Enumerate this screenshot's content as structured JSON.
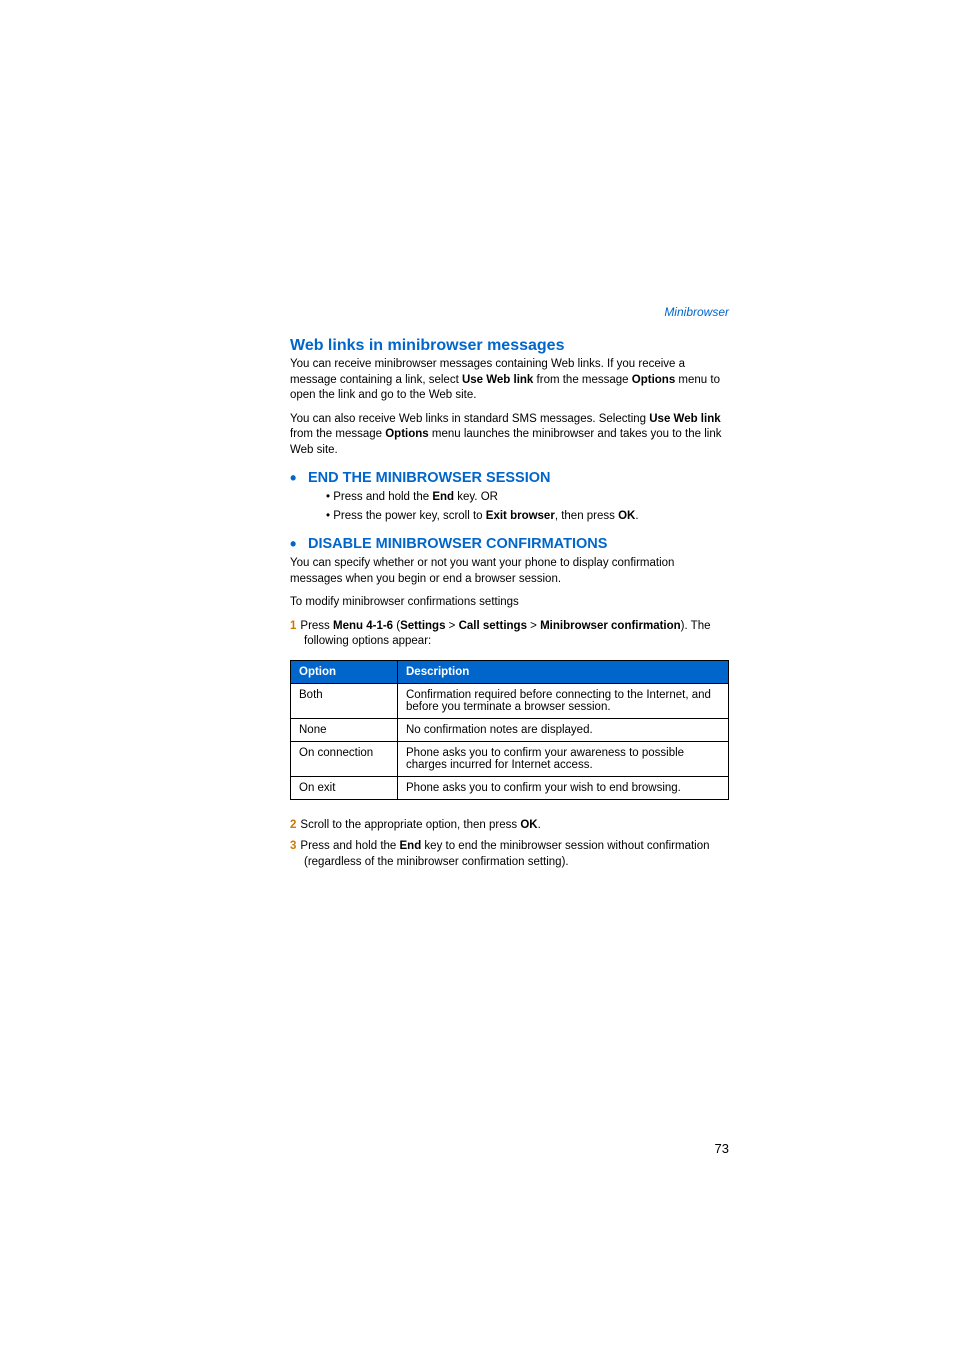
{
  "breadcrumb": "Minibrowser",
  "heading_weblinks": "Web links in minibrowser messages",
  "weblinks_p1_a": "You can receive minibrowser messages containing Web links. If you receive a message containing a link, select ",
  "weblinks_p1_b": "Use Web link",
  "weblinks_p1_c": " from the message ",
  "weblinks_p1_d": "Options",
  "weblinks_p1_e": " menu to open the link and go to the Web site.",
  "weblinks_p2_a": "You can also receive Web links in standard SMS messages. Selecting ",
  "weblinks_p2_b": "Use Web link",
  "weblinks_p2_c": " from the message ",
  "weblinks_p2_d": "Options",
  "weblinks_p2_e": " menu launches the minibrowser and takes you to the link Web site.",
  "heading_end": "END THE MINIBROWSER SESSION",
  "end_b1_a": "Press and hold the ",
  "end_b1_b": "End",
  "end_b1_c": " key. OR",
  "end_b2_a": "Press the power key, scroll to ",
  "end_b2_b": "Exit browser",
  "end_b2_c": ", then press ",
  "end_b2_d": "OK",
  "end_b2_e": ".",
  "heading_disable": "DISABLE MINIBROWSER CONFIRMATIONS",
  "disable_p1": "You can specify whether or not you want your phone to display confirmation messages when you begin or end a browser session.",
  "disable_p2": "To modify minibrowser confirmations settings",
  "step1_a": "Press ",
  "step1_b": "Menu 4-1-6",
  "step1_c": " (",
  "step1_d": "Settings",
  "step1_e": " > ",
  "step1_f": "Call settings",
  "step1_g": " > ",
  "step1_h": "Minibrowser confirmation",
  "step1_i": "). The following options appear:",
  "table": {
    "hdr_option": "Option",
    "hdr_desc": "Description",
    "r1o": "Both",
    "r1d": "Confirmation required before connecting to the Internet, and before you terminate a browser session.",
    "r2o": "None",
    "r2d": "No confirmation notes are displayed.",
    "r3o": "On connection",
    "r3d": "Phone asks you to confirm your awareness to possible charges incurred for Internet access.",
    "r4o": "On exit",
    "r4d": "Phone asks you to confirm your wish to end browsing."
  },
  "step2_a": "Scroll to the appropriate option, then press ",
  "step2_b": "OK",
  "step2_c": ".",
  "step3_a": "Press and hold the ",
  "step3_b": "End",
  "step3_c": " key to end the minibrowser session without confirmation (regardless of the minibrowser confirmation setting).",
  "page_number": "73"
}
